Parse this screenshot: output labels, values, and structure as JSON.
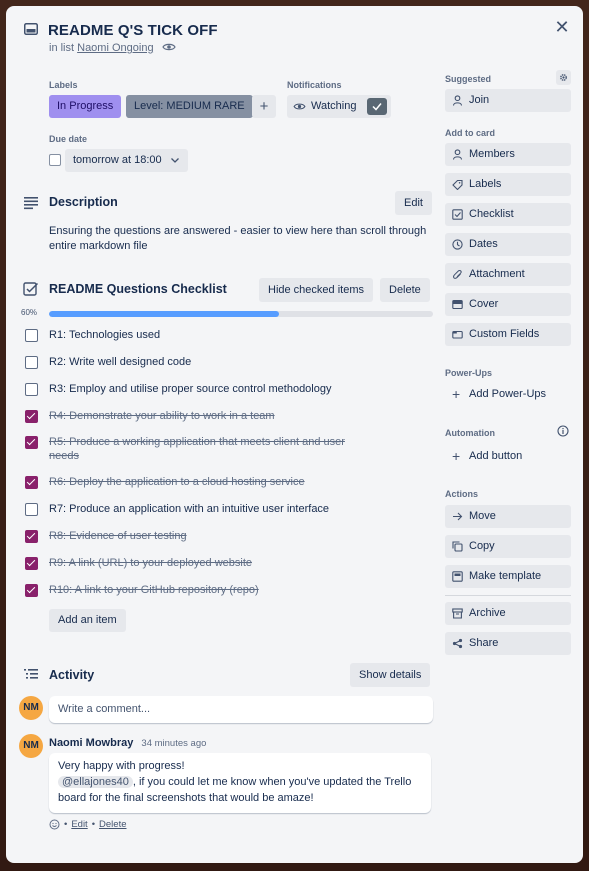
{
  "card": {
    "title": "README Q'S TICK OFF",
    "in_list_prefix": "in list",
    "list_name": "Naomi Ongoing"
  },
  "labels": {
    "heading": "Labels",
    "items": [
      {
        "text": "In Progress",
        "color": "#9f8fef"
      },
      {
        "text": "Level: MEDIUM RARE",
        "color": "#8590a2"
      }
    ],
    "add": "+"
  },
  "notifications": {
    "heading": "Notifications",
    "watch_label": "Watching"
  },
  "due_date": {
    "heading": "Due date",
    "value": "tomorrow at 18:00"
  },
  "description": {
    "heading": "Description",
    "edit_label": "Edit",
    "text": "Ensuring the questions are answered - easier to view here than scroll through entire markdown file"
  },
  "checklist": {
    "heading": "README Questions Checklist",
    "hide_label": "Hide checked items",
    "delete_label": "Delete",
    "progress_text": "60%",
    "progress": 0.6,
    "add_item_label": "Add an item",
    "items": [
      {
        "text": "R1: Technologies used",
        "checked": false
      },
      {
        "text": "R2: Write well designed code",
        "checked": false
      },
      {
        "text": "R3: Employ and utilise proper source control methodology",
        "checked": false
      },
      {
        "text": "R4: Demonstrate your ability to work in a team",
        "checked": true
      },
      {
        "text": "R5: Produce a working application that meets client and user needs",
        "checked": true
      },
      {
        "text": "R6: Deploy the application to a cloud hosting service",
        "checked": true
      },
      {
        "text": "R7: Produce an application with an intuitive user interface",
        "checked": false
      },
      {
        "text": "R8: Evidence of user testing",
        "checked": true
      },
      {
        "text": "R9: A link (URL) to your deployed website",
        "checked": true
      },
      {
        "text": "R10: A link to your GitHub repository (repo)",
        "checked": true
      }
    ]
  },
  "activity": {
    "heading": "Activity",
    "show_details_label": "Show details",
    "avatar_initials": "NM",
    "comment_placeholder": "Write a comment...",
    "comments": [
      {
        "author": "Naomi Mowbray",
        "initials": "NM",
        "time": "34 minutes ago",
        "line1": "Very happy with progress!",
        "mention": "@ellajones40",
        "line2_rest": ", if you could let me know when you've updated the Trello",
        "line3": "board for the final screenshots that would be amaze!",
        "edit_label": "Edit",
        "delete_label": "Delete"
      }
    ]
  },
  "sidebar": {
    "suggested_heading": "Suggested",
    "join_label": "Join",
    "add_to_card_heading": "Add to card",
    "add_to_card": [
      "Members",
      "Labels",
      "Checklist",
      "Dates",
      "Attachment",
      "Cover",
      "Custom Fields"
    ],
    "powerups_heading": "Power-Ups",
    "add_powerups_label": "Add Power-Ups",
    "automation_heading": "Automation",
    "add_button_label": "Add button",
    "actions_heading": "Actions",
    "actions": [
      "Move",
      "Copy",
      "Make template"
    ],
    "archive_label": "Archive",
    "share_label": "Share"
  },
  "colors": {
    "checked": "#89216b",
    "progress": "#579dff",
    "avatar": "#f5a742"
  }
}
